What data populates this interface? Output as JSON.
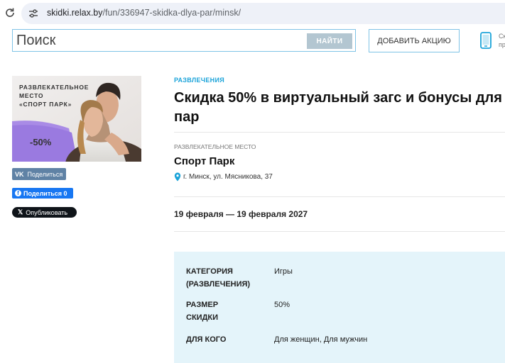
{
  "browser": {
    "url_host": "skidki.relax.by",
    "url_path": "/fun/336947-skidka-dlya-par/minsk/"
  },
  "header": {
    "search_placeholder": "Поиск",
    "search_button": "НАЙТИ",
    "add_promo_button": "ДОБАВИТЬ АКЦИЮ",
    "app_promo_cut_1": "Ск",
    "app_promo_cut_2": "пр"
  },
  "promo_image": {
    "text_line1": "РАЗВЛЕКАТЕЛЬНОЕ",
    "text_line2": "МЕСТО",
    "text_line3": "«СПОРТ ПАРК»",
    "discount": "-50%"
  },
  "share": {
    "vk_label": "Поделиться",
    "vk_logo": "VK",
    "fb_label": "Поделиться 0",
    "x_label": "Опубликовать"
  },
  "offer": {
    "category": "РАЗВЛЕЧЕНИЯ",
    "title": "Скидка 50% в виртуальный загс и бонусы для пар",
    "place_label": "РАЗВЛЕКАТЕЛЬНОЕ МЕСТО",
    "place_name": "Спорт Парк",
    "address": "г. Минск, ул. Мясникова, 37",
    "dates": "19 февраля — 19 февраля 2027"
  },
  "details": [
    {
      "key": "КАТЕГОРИЯ (РАЗВЛЕЧЕНИЯ)",
      "value": "Игры"
    },
    {
      "key": "РАЗМЕР СКИДКИ",
      "value": "50%"
    },
    {
      "key": "ДЛЯ КОГО",
      "value": "Для женщин, Для мужчин"
    }
  ],
  "colors": {
    "accent": "#1aa3d9",
    "info_bg": "#e4f4fa",
    "search_button_bg": "#b3c6d1"
  }
}
